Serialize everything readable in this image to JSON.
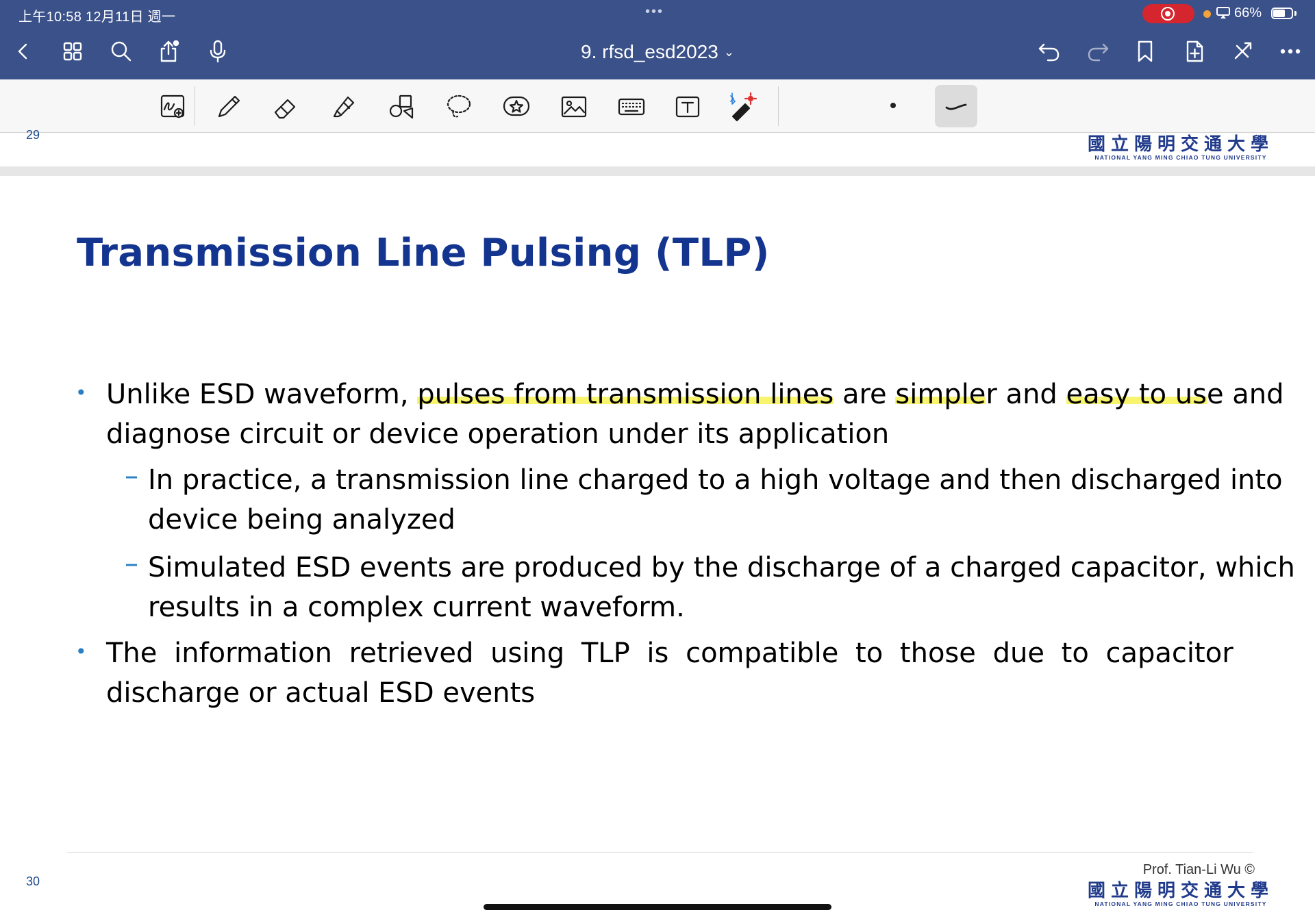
{
  "status_bar": {
    "time": "上午10:58  12月11日 週一",
    "dots": "•••",
    "battery_percent": "66%",
    "battery_level": 0.66
  },
  "nav": {
    "document_title": "9. rfsd_esd2023",
    "title_chevron": "⌄",
    "left_icons": [
      "back-icon",
      "grid-icon",
      "search-icon",
      "share-icon",
      "microphone-icon"
    ],
    "right_icons": [
      "undo-icon",
      "redo-icon",
      "bookmark-icon",
      "add-page-icon",
      "close-tools-icon",
      "more-icon"
    ]
  },
  "toolbar": {
    "tools": [
      "handwriting-zoom-icon",
      "pen-icon",
      "eraser-icon",
      "highlighter-icon",
      "shapes-icon",
      "lasso-icon",
      "sticker-icon",
      "image-icon",
      "keyboard-icon",
      "text-box-icon",
      "laser-pointer-icon"
    ],
    "active_tool": "stroke-style-icon"
  },
  "previous_page": {
    "page_number": "29"
  },
  "logo": {
    "chinese": "國立陽明交通大學",
    "english": "NATIONAL YANG MING CHIAO TUNG UNIVERSITY"
  },
  "slide": {
    "title": "Transmission Line Pulsing (TLP)",
    "bullet1": {
      "line1_a": "Unlike ESD waveform, ",
      "line1_hl1": "pulses from transmission lines",
      "line1_b": " are ",
      "line1_hl2": "simple",
      "line1_c": "r and ",
      "line1_hl3": "easy to us",
      "line1_d": "e and",
      "line2": "diagnose circuit or device operation under its application"
    },
    "sub1": {
      "line1": "In practice, a transmission line charged to a high voltage and then discharged into",
      "line2": "device being analyzed"
    },
    "sub2": {
      "line1": "Simulated ESD events are produced by the discharge of a charged capacitor, which",
      "line2": "results in a complex current waveform."
    },
    "bullet2": {
      "line1": "The information retrieved using TLP is compatible to those due to capacitor",
      "line2": "discharge or actual ESD events"
    },
    "footer_credit": "Prof. Tian-Li Wu ©",
    "page_number": "30",
    "bullet_symbol": "•",
    "dash_symbol": "–"
  }
}
